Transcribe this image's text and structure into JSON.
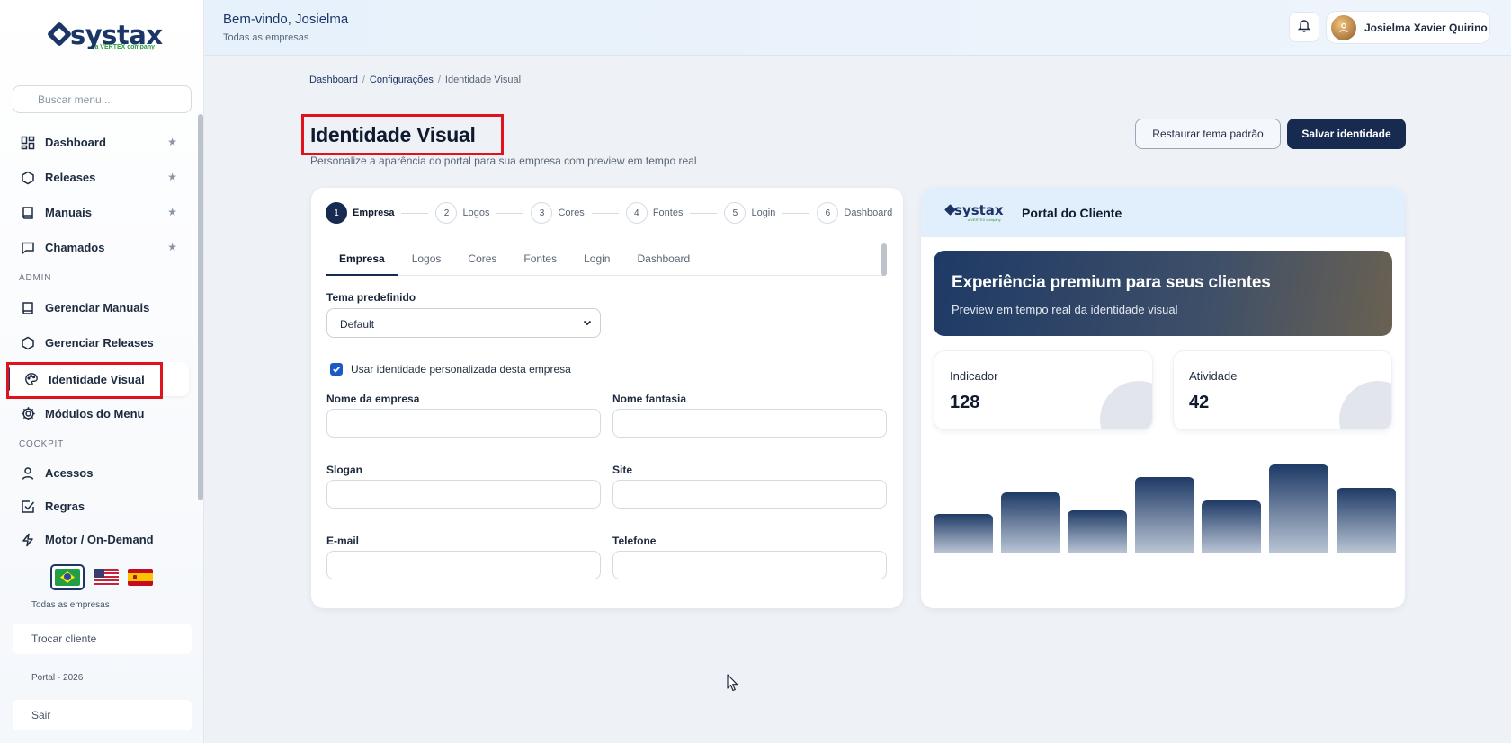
{
  "brand": {
    "logo_text": "systax",
    "logo_sub": "a VERTEX company"
  },
  "sidebar": {
    "search_placeholder": "Buscar menu...",
    "items": [
      {
        "label": "Dashboard",
        "icon": "dashboard-grid-icon",
        "starred": true
      },
      {
        "label": "Releases",
        "icon": "hexagon-icon",
        "starred": true
      },
      {
        "label": "Manuais",
        "icon": "book-icon",
        "starred": true
      },
      {
        "label": "Chamados",
        "icon": "chat-icon",
        "starred": true
      }
    ],
    "section_admin": "ADMIN",
    "admin_items": [
      {
        "label": "Gerenciar Manuais",
        "icon": "book-icon"
      },
      {
        "label": "Gerenciar Releases",
        "icon": "hexagon-icon"
      },
      {
        "label": "Identidade Visual",
        "icon": "palette-icon",
        "active": true
      },
      {
        "label": "Módulos do Menu",
        "icon": "gear-icon"
      }
    ],
    "section_cockpit": "COCKPIT",
    "cockpit_items": [
      {
        "label": "Acessos",
        "icon": "user-icon"
      },
      {
        "label": "Regras",
        "icon": "checkbox-icon"
      },
      {
        "label": "Motor / On-Demand",
        "icon": "lightning-icon"
      }
    ],
    "star_glyph": "★",
    "company_scope": "Todas as empresas",
    "switch_client": "Trocar cliente",
    "portal_version": "Portal - 2026",
    "logout": "Sair"
  },
  "header": {
    "welcome": "Bem-vindo, Josielma",
    "subtitle": "Todas as empresas",
    "user_name": "Josielma Xavier Quirino"
  },
  "breadcrumb": [
    "Dashboard",
    "Configurações",
    "Identidade Visual"
  ],
  "breadcrumb_sep": "/",
  "page": {
    "title": "Identidade Visual",
    "subtitle": "Personalize a aparência do portal para sua empresa com preview em tempo real",
    "restore_button": "Restaurar tema padrão",
    "save_button": "Salvar identidade"
  },
  "steps": [
    {
      "num": "1",
      "label": "Empresa",
      "active": true
    },
    {
      "num": "2",
      "label": "Logos"
    },
    {
      "num": "3",
      "label": "Cores"
    },
    {
      "num": "4",
      "label": "Fontes"
    },
    {
      "num": "5",
      "label": "Login"
    },
    {
      "num": "6",
      "label": "Dashboard"
    }
  ],
  "tabs": [
    "Empresa",
    "Logos",
    "Cores",
    "Fontes",
    "Login",
    "Dashboard"
  ],
  "form": {
    "theme_label": "Tema predefinido",
    "theme_value": "Default",
    "custom_identity_label": "Usar identidade personalizada desta empresa",
    "custom_identity_checked": true,
    "company_name_label": "Nome da empresa",
    "trade_name_label": "Nome fantasia",
    "slogan_label": "Slogan",
    "site_label": "Site",
    "email_label": "E-mail",
    "phone_label": "Telefone",
    "company_name_value": "",
    "trade_name_value": "",
    "slogan_value": "",
    "site_value": "",
    "email_value": "",
    "phone_value": ""
  },
  "preview": {
    "title": "Portal do Cliente",
    "hero_title": "Experiência premium para seus clientes",
    "hero_subtitle": "Preview em tempo real da identidade visual",
    "stats": [
      {
        "label": "Indicador",
        "value": "128"
      },
      {
        "label": "Atividade",
        "value": "42"
      }
    ],
    "bar_values": [
      40,
      62,
      44,
      78,
      54,
      91,
      67
    ],
    "bar_max": 91
  },
  "colors": {
    "primary": "#172a4f",
    "accent": "#1b3566",
    "highlight": "#e0121b"
  }
}
